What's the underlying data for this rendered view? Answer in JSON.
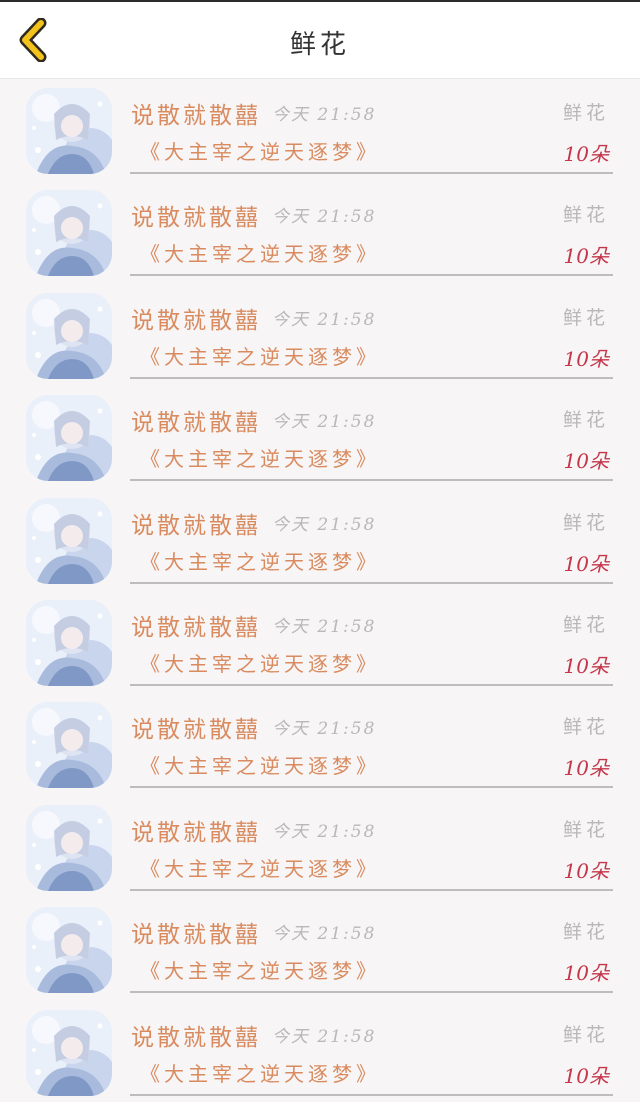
{
  "header": {
    "title": "鲜花",
    "back_icon": "chevron-left-icon",
    "back_icon_color": "#f2c31c"
  },
  "colors": {
    "sender": "#d98b5f",
    "time": "#b8b8b8",
    "count": "#c4374b"
  },
  "gifts": [
    {
      "sender": "说散就散囍",
      "time": "今天 21:58",
      "gift": "鲜花",
      "book": "《大主宰之逆天逐梦》",
      "count": "10朵"
    },
    {
      "sender": "说散就散囍",
      "time": "今天 21:58",
      "gift": "鲜花",
      "book": "《大主宰之逆天逐梦》",
      "count": "10朵"
    },
    {
      "sender": "说散就散囍",
      "time": "今天 21:58",
      "gift": "鲜花",
      "book": "《大主宰之逆天逐梦》",
      "count": "10朵"
    },
    {
      "sender": "说散就散囍",
      "time": "今天 21:58",
      "gift": "鲜花",
      "book": "《大主宰之逆天逐梦》",
      "count": "10朵"
    },
    {
      "sender": "说散就散囍",
      "time": "今天 21:58",
      "gift": "鲜花",
      "book": "《大主宰之逆天逐梦》",
      "count": "10朵"
    },
    {
      "sender": "说散就散囍",
      "time": "今天 21:58",
      "gift": "鲜花",
      "book": "《大主宰之逆天逐梦》",
      "count": "10朵"
    },
    {
      "sender": "说散就散囍",
      "time": "今天 21:58",
      "gift": "鲜花",
      "book": "《大主宰之逆天逐梦》",
      "count": "10朵"
    },
    {
      "sender": "说散就散囍",
      "time": "今天 21:58",
      "gift": "鲜花",
      "book": "《大主宰之逆天逐梦》",
      "count": "10朵"
    },
    {
      "sender": "说散就散囍",
      "time": "今天 21:58",
      "gift": "鲜花",
      "book": "《大主宰之逆天逐梦》",
      "count": "10朵"
    },
    {
      "sender": "说散就散囍",
      "time": "今天 21:58",
      "gift": "鲜花",
      "book": "《大主宰之逆天逐梦》",
      "count": "10朵"
    }
  ]
}
